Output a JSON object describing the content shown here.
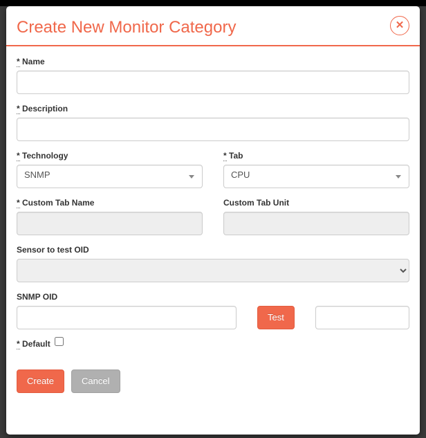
{
  "modal": {
    "title": "Create New Monitor Category"
  },
  "labels": {
    "name": "Name",
    "description": "Description",
    "technology": "Technology",
    "tab": "Tab",
    "custom_tab_name": "Custom Tab Name",
    "custom_tab_unit": "Custom Tab Unit",
    "sensor_to_test_oid": "Sensor to test OID",
    "snmp_oid": "SNMP OID",
    "default": "Default",
    "required_marker": "*"
  },
  "values": {
    "name": "",
    "description": "",
    "technology_selected": "SNMP",
    "tab_selected": "CPU",
    "custom_tab_name": "",
    "custom_tab_unit": "",
    "sensor_selected": "",
    "snmp_oid": "",
    "test_result": ""
  },
  "buttons": {
    "test": "Test",
    "create": "Create",
    "cancel": "Cancel",
    "close": "✕"
  }
}
